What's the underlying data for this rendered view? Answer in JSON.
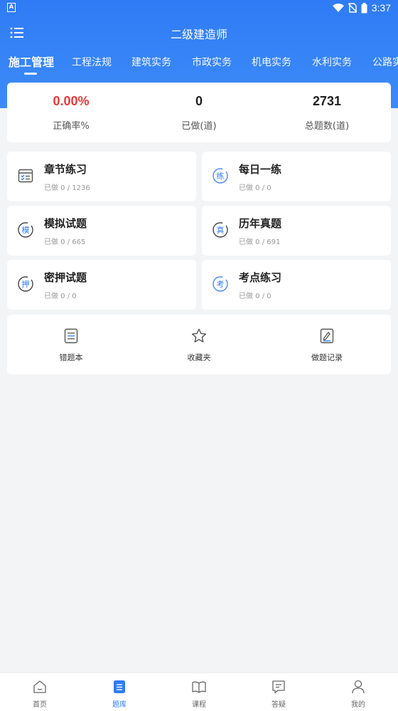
{
  "status_bar": {
    "time": "3:37",
    "notif_icon": "A"
  },
  "header": {
    "title": "二级建造师"
  },
  "tabs": [
    {
      "label": "施工管理",
      "active": true
    },
    {
      "label": "工程法规"
    },
    {
      "label": "建筑实务"
    },
    {
      "label": "市政实务"
    },
    {
      "label": "机电实务"
    },
    {
      "label": "水利实务"
    },
    {
      "label": "公路实"
    }
  ],
  "stats": [
    {
      "value": "0.00%",
      "label": "正确率%"
    },
    {
      "value": "0",
      "label": "已做(道)"
    },
    {
      "value": "2731",
      "label": "总题数(道)"
    }
  ],
  "practice": [
    {
      "name": "章节练习",
      "sub": "已做 0 / 1236",
      "icon": "chapter-icon"
    },
    {
      "name": "每日一练",
      "sub": "已做 0 / 0",
      "icon": "daily-icon",
      "glyph": "练"
    },
    {
      "name": "模拟试题",
      "sub": "已做 0 / 665",
      "icon": "mock-icon",
      "glyph": "模"
    },
    {
      "name": "历年真题",
      "sub": "已做 0 / 691",
      "icon": "real-icon",
      "glyph": "真"
    },
    {
      "name": "密押试题",
      "sub": "已做 0 / 0",
      "icon": "secret-icon",
      "glyph": "押"
    },
    {
      "name": "考点练习",
      "sub": "已做 0 / 0",
      "icon": "point-icon",
      "glyph": "考"
    }
  ],
  "tools": [
    {
      "label": "错题本",
      "icon": "wrongbook-icon"
    },
    {
      "label": "收藏夹",
      "icon": "star-icon"
    },
    {
      "label": "做题记录",
      "icon": "record-icon"
    }
  ],
  "bottom_nav": [
    {
      "label": "首页",
      "icon": "home-icon"
    },
    {
      "label": "题库",
      "icon": "question-bank-icon",
      "active": true
    },
    {
      "label": "课程",
      "icon": "course-icon"
    },
    {
      "label": "答疑",
      "icon": "qa-icon"
    },
    {
      "label": "我的",
      "icon": "profile-icon"
    }
  ],
  "colors": {
    "primary": "#2f7bf5",
    "accent_red": "#e33b3b",
    "background": "#f3f4f6"
  }
}
